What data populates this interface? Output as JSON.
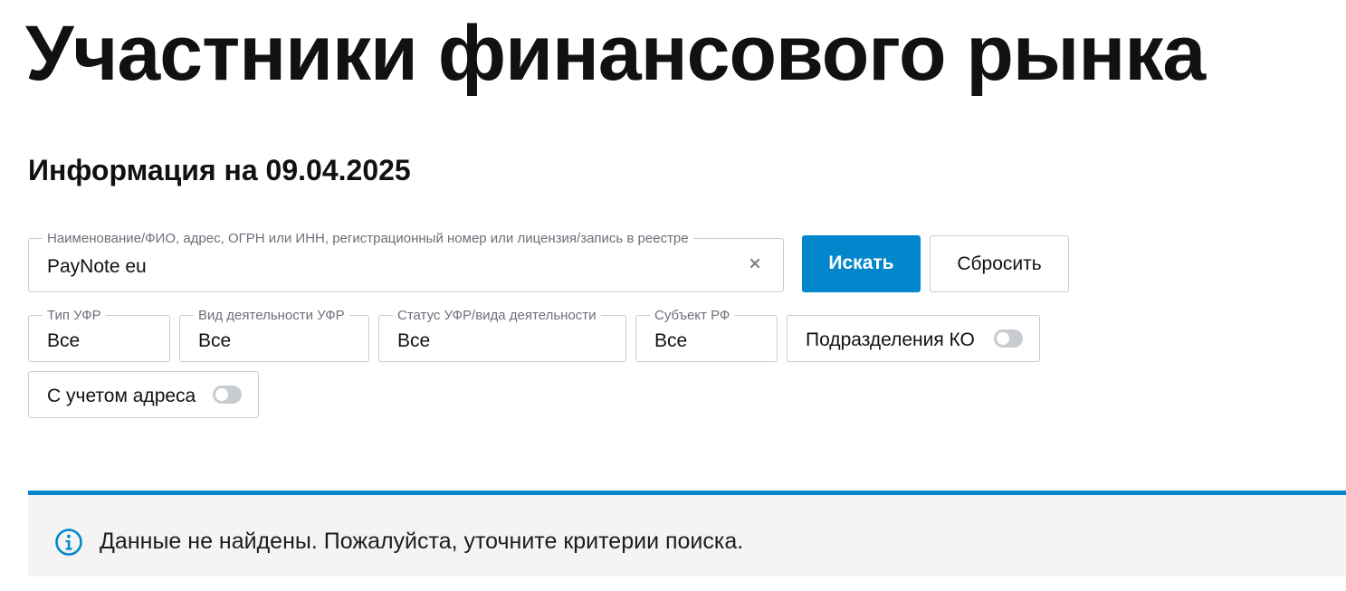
{
  "page": {
    "title": "Участники финансового рынка",
    "info_date": "Информация на 09.04.2025"
  },
  "search": {
    "label": "Наименование/ФИО, адрес, ОГРН или ИНН, регистрационный номер или лицензия/запись в реестре",
    "value": "PayNote eu",
    "clear_icon": "close-icon",
    "submit_label": "Искать",
    "reset_label": "Сбросить"
  },
  "filters": {
    "type": {
      "label": "Тип УФР",
      "value": "Все"
    },
    "activity": {
      "label": "Вид деятельности УФР",
      "value": "Все"
    },
    "status": {
      "label": "Статус УФР/вида деятельности",
      "value": "Все"
    },
    "region": {
      "label": "Субъект РФ",
      "value": "Все"
    },
    "ko_divisions": {
      "label": "Подразделения КО",
      "enabled": false
    },
    "with_address": {
      "label": "С учетом адреса",
      "enabled": false
    }
  },
  "result": {
    "message": "Данные не найдены. Пожалуйста, уточните критерии поиска.",
    "icon": "info-icon"
  },
  "colors": {
    "accent": "#0387cc",
    "border": "#c9ccd1",
    "notice_background": "#f4f4f4",
    "toggle_off": "#c8cbd0"
  }
}
